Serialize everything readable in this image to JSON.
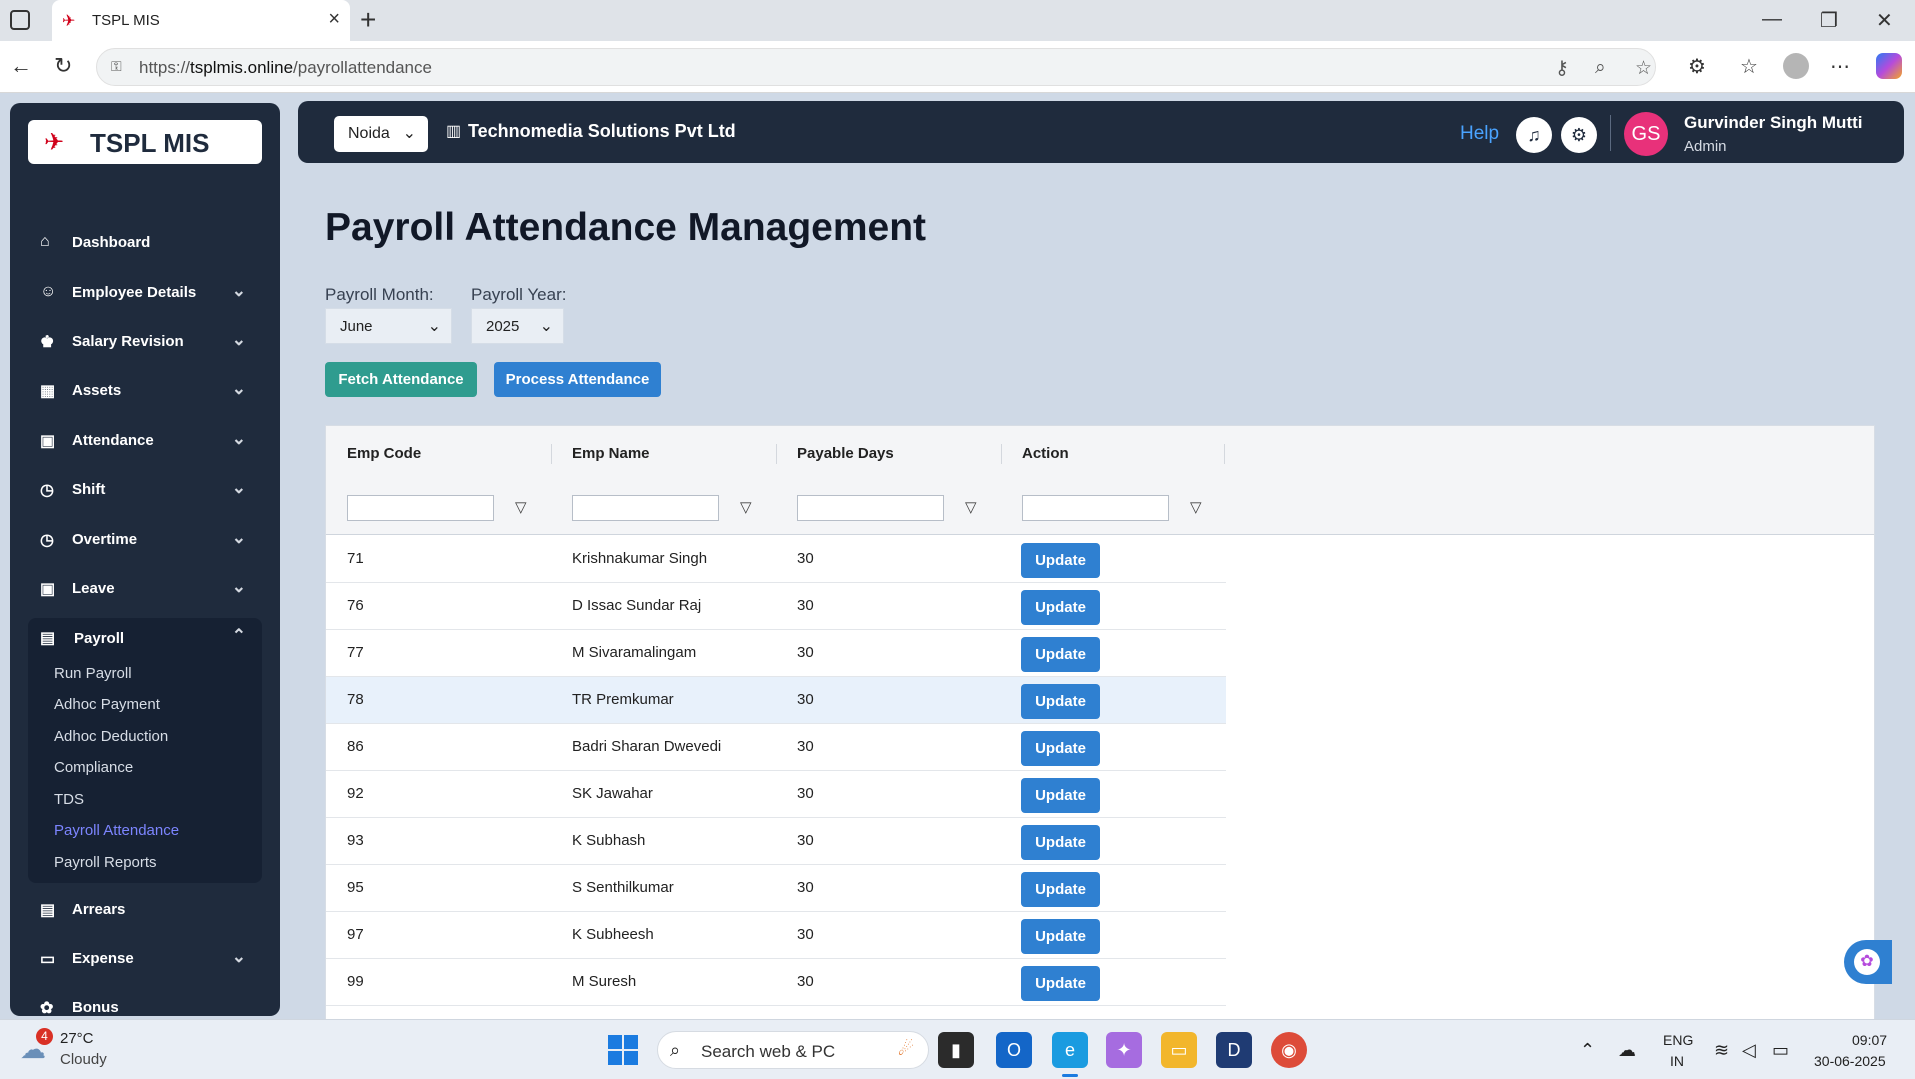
{
  "browser": {
    "tab_title": "TSPL MIS",
    "url_domain": "tsplmis.online",
    "url_prefix": "https://",
    "url_path": "/payrollattendance"
  },
  "sidebar": {
    "logo": "TSPL MIS",
    "items": [
      {
        "label": "Dashboard",
        "icon": "home-icon"
      },
      {
        "label": "Employee Details",
        "icon": "users-icon"
      },
      {
        "label": "Salary Revision",
        "icon": "money-bag-icon"
      },
      {
        "label": "Assets",
        "icon": "boxes-icon"
      },
      {
        "label": "Attendance",
        "icon": "calendar-icon"
      },
      {
        "label": "Shift",
        "icon": "clock-icon"
      },
      {
        "label": "Overtime",
        "icon": "clock-icon"
      },
      {
        "label": "Leave",
        "icon": "calendar-icon"
      }
    ],
    "payroll": {
      "label": "Payroll",
      "sub": [
        "Run Payroll",
        "Adhoc Payment",
        "Adhoc Deduction",
        "Compliance",
        "TDS",
        "Payroll Attendance",
        "Payroll Reports"
      ],
      "active": "Payroll Attendance"
    },
    "after": [
      {
        "label": "Arrears",
        "icon": "cash-icon"
      },
      {
        "label": "Expense",
        "icon": "wallet-icon"
      },
      {
        "label": "Bonus",
        "icon": "gift-icon"
      }
    ]
  },
  "header": {
    "location": "Noida",
    "company": "Technomedia Solutions Pvt Ltd",
    "help": "Help",
    "avatar_initials": "GS",
    "user_name": "Gurvinder Singh Mutti",
    "user_role": "Admin"
  },
  "main": {
    "title": "Payroll Attendance Management",
    "month_label": "Payroll Month:",
    "month_value": "June",
    "year_label": "Payroll Year:",
    "year_value": "2025",
    "fetch_button": "Fetch Attendance",
    "process_button": "Process Attendance",
    "columns": [
      "Emp Code",
      "Emp Name",
      "Payable Days",
      "Action"
    ],
    "update_label": "Update",
    "rows": [
      {
        "code": "71",
        "name": "Krishnakumar Singh",
        "days": "30"
      },
      {
        "code": "76",
        "name": "D Issac Sundar Raj",
        "days": "30"
      },
      {
        "code": "77",
        "name": "M Sivaramalingam",
        "days": "30"
      },
      {
        "code": "78",
        "name": "TR Premkumar",
        "days": "30"
      },
      {
        "code": "86",
        "name": "Badri Sharan Dwevedi",
        "days": "30"
      },
      {
        "code": "92",
        "name": "SK Jawahar",
        "days": "30"
      },
      {
        "code": "93",
        "name": "K Subhash",
        "days": "30"
      },
      {
        "code": "95",
        "name": "S Senthilkumar",
        "days": "30"
      },
      {
        "code": "97",
        "name": "K Subheesh",
        "days": "30"
      },
      {
        "code": "99",
        "name": "M Suresh",
        "days": "30"
      }
    ]
  },
  "taskbar": {
    "temp": "27°C",
    "weather": "Cloudy",
    "weather_badge": "4",
    "search_placeholder": "Search web & PC",
    "lang1": "ENG",
    "lang2": "IN",
    "time": "09:07",
    "date": "30-06-2025"
  },
  "colors": {
    "sidebar_bg": "#1f2b3d",
    "accent_blue": "#2f80d1",
    "accent_teal": "#2f9c8f",
    "active_link": "#7c85ff",
    "avatar": "#e8317a"
  }
}
